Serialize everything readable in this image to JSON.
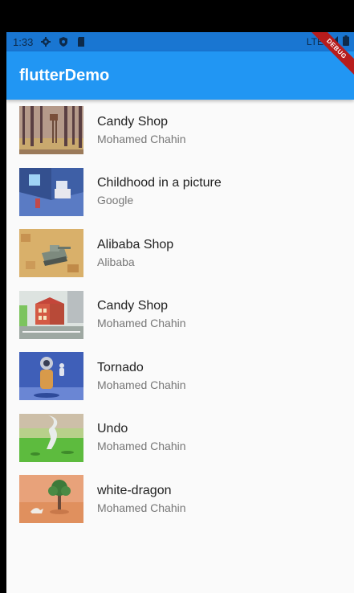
{
  "status_bar": {
    "time": "1:33",
    "network": "LTE"
  },
  "app_bar": {
    "title": "flutterDemo",
    "debug_label": "DEBUG"
  },
  "items": [
    {
      "title": "Candy Shop",
      "subtitle": "Mohamed Chahin",
      "image": "forest-tower-illustration"
    },
    {
      "title": "Childhood in a picture",
      "subtitle": "Google",
      "image": "isometric-room-illustration"
    },
    {
      "title": "Alibaba Shop",
      "subtitle": "Alibaba",
      "image": "desert-tank-illustration"
    },
    {
      "title": "Candy Shop",
      "subtitle": "Mohamed Chahin",
      "image": "city-house-illustration"
    },
    {
      "title": "Tornado",
      "subtitle": "Mohamed Chahin",
      "image": "astronaut-illustration"
    },
    {
      "title": "Undo",
      "subtitle": "Mohamed Chahin",
      "image": "grass-tornado-illustration"
    },
    {
      "title": "white-dragon",
      "subtitle": "Mohamed Chahin",
      "image": "tree-dragon-illustration"
    }
  ]
}
